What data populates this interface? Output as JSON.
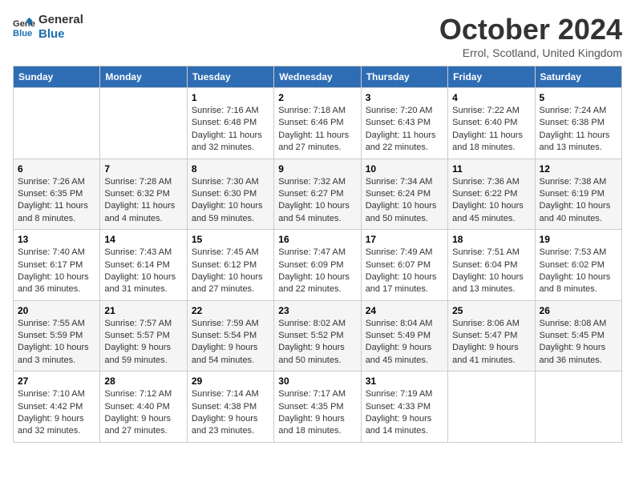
{
  "logo": {
    "line1": "General",
    "line2": "Blue"
  },
  "title": "October 2024",
  "location": "Errol, Scotland, United Kingdom",
  "weekdays": [
    "Sunday",
    "Monday",
    "Tuesday",
    "Wednesday",
    "Thursday",
    "Friday",
    "Saturday"
  ],
  "weeks": [
    [
      {
        "num": "",
        "sunrise": "",
        "sunset": "",
        "daylight": ""
      },
      {
        "num": "",
        "sunrise": "",
        "sunset": "",
        "daylight": ""
      },
      {
        "num": "1",
        "sunrise": "Sunrise: 7:16 AM",
        "sunset": "Sunset: 6:48 PM",
        "daylight": "Daylight: 11 hours and 32 minutes."
      },
      {
        "num": "2",
        "sunrise": "Sunrise: 7:18 AM",
        "sunset": "Sunset: 6:46 PM",
        "daylight": "Daylight: 11 hours and 27 minutes."
      },
      {
        "num": "3",
        "sunrise": "Sunrise: 7:20 AM",
        "sunset": "Sunset: 6:43 PM",
        "daylight": "Daylight: 11 hours and 22 minutes."
      },
      {
        "num": "4",
        "sunrise": "Sunrise: 7:22 AM",
        "sunset": "Sunset: 6:40 PM",
        "daylight": "Daylight: 11 hours and 18 minutes."
      },
      {
        "num": "5",
        "sunrise": "Sunrise: 7:24 AM",
        "sunset": "Sunset: 6:38 PM",
        "daylight": "Daylight: 11 hours and 13 minutes."
      }
    ],
    [
      {
        "num": "6",
        "sunrise": "Sunrise: 7:26 AM",
        "sunset": "Sunset: 6:35 PM",
        "daylight": "Daylight: 11 hours and 8 minutes."
      },
      {
        "num": "7",
        "sunrise": "Sunrise: 7:28 AM",
        "sunset": "Sunset: 6:32 PM",
        "daylight": "Daylight: 11 hours and 4 minutes."
      },
      {
        "num": "8",
        "sunrise": "Sunrise: 7:30 AM",
        "sunset": "Sunset: 6:30 PM",
        "daylight": "Daylight: 10 hours and 59 minutes."
      },
      {
        "num": "9",
        "sunrise": "Sunrise: 7:32 AM",
        "sunset": "Sunset: 6:27 PM",
        "daylight": "Daylight: 10 hours and 54 minutes."
      },
      {
        "num": "10",
        "sunrise": "Sunrise: 7:34 AM",
        "sunset": "Sunset: 6:24 PM",
        "daylight": "Daylight: 10 hours and 50 minutes."
      },
      {
        "num": "11",
        "sunrise": "Sunrise: 7:36 AM",
        "sunset": "Sunset: 6:22 PM",
        "daylight": "Daylight: 10 hours and 45 minutes."
      },
      {
        "num": "12",
        "sunrise": "Sunrise: 7:38 AM",
        "sunset": "Sunset: 6:19 PM",
        "daylight": "Daylight: 10 hours and 40 minutes."
      }
    ],
    [
      {
        "num": "13",
        "sunrise": "Sunrise: 7:40 AM",
        "sunset": "Sunset: 6:17 PM",
        "daylight": "Daylight: 10 hours and 36 minutes."
      },
      {
        "num": "14",
        "sunrise": "Sunrise: 7:43 AM",
        "sunset": "Sunset: 6:14 PM",
        "daylight": "Daylight: 10 hours and 31 minutes."
      },
      {
        "num": "15",
        "sunrise": "Sunrise: 7:45 AM",
        "sunset": "Sunset: 6:12 PM",
        "daylight": "Daylight: 10 hours and 27 minutes."
      },
      {
        "num": "16",
        "sunrise": "Sunrise: 7:47 AM",
        "sunset": "Sunset: 6:09 PM",
        "daylight": "Daylight: 10 hours and 22 minutes."
      },
      {
        "num": "17",
        "sunrise": "Sunrise: 7:49 AM",
        "sunset": "Sunset: 6:07 PM",
        "daylight": "Daylight: 10 hours and 17 minutes."
      },
      {
        "num": "18",
        "sunrise": "Sunrise: 7:51 AM",
        "sunset": "Sunset: 6:04 PM",
        "daylight": "Daylight: 10 hours and 13 minutes."
      },
      {
        "num": "19",
        "sunrise": "Sunrise: 7:53 AM",
        "sunset": "Sunset: 6:02 PM",
        "daylight": "Daylight: 10 hours and 8 minutes."
      }
    ],
    [
      {
        "num": "20",
        "sunrise": "Sunrise: 7:55 AM",
        "sunset": "Sunset: 5:59 PM",
        "daylight": "Daylight: 10 hours and 3 minutes."
      },
      {
        "num": "21",
        "sunrise": "Sunrise: 7:57 AM",
        "sunset": "Sunset: 5:57 PM",
        "daylight": "Daylight: 9 hours and 59 minutes."
      },
      {
        "num": "22",
        "sunrise": "Sunrise: 7:59 AM",
        "sunset": "Sunset: 5:54 PM",
        "daylight": "Daylight: 9 hours and 54 minutes."
      },
      {
        "num": "23",
        "sunrise": "Sunrise: 8:02 AM",
        "sunset": "Sunset: 5:52 PM",
        "daylight": "Daylight: 9 hours and 50 minutes."
      },
      {
        "num": "24",
        "sunrise": "Sunrise: 8:04 AM",
        "sunset": "Sunset: 5:49 PM",
        "daylight": "Daylight: 9 hours and 45 minutes."
      },
      {
        "num": "25",
        "sunrise": "Sunrise: 8:06 AM",
        "sunset": "Sunset: 5:47 PM",
        "daylight": "Daylight: 9 hours and 41 minutes."
      },
      {
        "num": "26",
        "sunrise": "Sunrise: 8:08 AM",
        "sunset": "Sunset: 5:45 PM",
        "daylight": "Daylight: 9 hours and 36 minutes."
      }
    ],
    [
      {
        "num": "27",
        "sunrise": "Sunrise: 7:10 AM",
        "sunset": "Sunset: 4:42 PM",
        "daylight": "Daylight: 9 hours and 32 minutes."
      },
      {
        "num": "28",
        "sunrise": "Sunrise: 7:12 AM",
        "sunset": "Sunset: 4:40 PM",
        "daylight": "Daylight: 9 hours and 27 minutes."
      },
      {
        "num": "29",
        "sunrise": "Sunrise: 7:14 AM",
        "sunset": "Sunset: 4:38 PM",
        "daylight": "Daylight: 9 hours and 23 minutes."
      },
      {
        "num": "30",
        "sunrise": "Sunrise: 7:17 AM",
        "sunset": "Sunset: 4:35 PM",
        "daylight": "Daylight: 9 hours and 18 minutes."
      },
      {
        "num": "31",
        "sunrise": "Sunrise: 7:19 AM",
        "sunset": "Sunset: 4:33 PM",
        "daylight": "Daylight: 9 hours and 14 minutes."
      },
      {
        "num": "",
        "sunrise": "",
        "sunset": "",
        "daylight": ""
      },
      {
        "num": "",
        "sunrise": "",
        "sunset": "",
        "daylight": ""
      }
    ]
  ]
}
